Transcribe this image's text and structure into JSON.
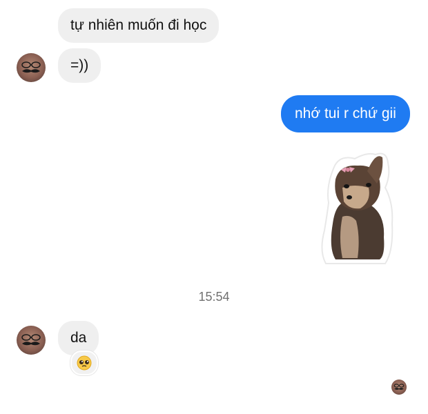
{
  "messages": {
    "incoming_1": {
      "text": "tự nhiên muốn đi học"
    },
    "incoming_2": {
      "text": "=))"
    },
    "outgoing_1": {
      "text": "nhớ tui r chứ gii"
    },
    "timestamp": "15:54",
    "incoming_3": {
      "text": "da",
      "reaction": "🥺"
    }
  },
  "colors": {
    "outgoing_bubble": "#1f7bf2",
    "incoming_bubble": "#efefef",
    "timestamp_text": "#707070"
  },
  "icons": {
    "avatar": "avatar-mustache-icon",
    "sticker": "chihuahua-sticker",
    "seen": "seen-avatar-icon"
  }
}
